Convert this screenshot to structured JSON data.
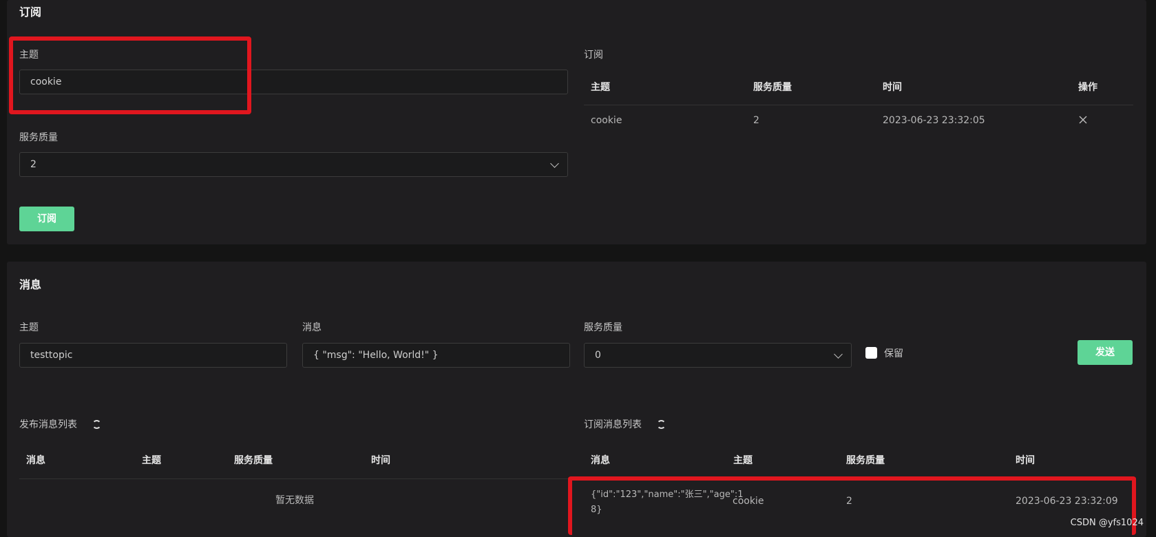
{
  "subscribe": {
    "title": "订阅",
    "topic_label": "主题",
    "topic_value": "cookie",
    "qos_label": "服务质量",
    "qos_value": "2",
    "button": "订阅",
    "list_title": "订阅",
    "headers": [
      "主题",
      "服务质量",
      "时间",
      "操作"
    ],
    "rows": [
      {
        "topic": "cookie",
        "qos": "2",
        "time": "2023-06-23 23:32:05"
      }
    ]
  },
  "message": {
    "title": "消息",
    "topic_label": "主题",
    "topic_value": "testtopic",
    "payload_label": "消息",
    "payload_value": "{ \"msg\": \"Hello, World!\" }",
    "qos_label": "服务质量",
    "qos_value": "0",
    "retain_label": "保留",
    "send_button": "发送",
    "published_title": "发布消息列表",
    "published_headers": [
      "消息",
      "主题",
      "服务质量",
      "时间"
    ],
    "published_empty": "暂无数据",
    "received_title": "订阅消息列表",
    "received_headers": [
      "消息",
      "主题",
      "服务质量",
      "时间"
    ],
    "received_rows": [
      {
        "message_line1": "{\"id\":\"123\",\"name\":\"张三\",\"age\":1",
        "message_line2": "8}",
        "topic": "cookie",
        "qos": "2",
        "time": "2023-06-23 23:32:09"
      }
    ]
  },
  "watermark": "CSDN @yfs1024",
  "colors": {
    "accent": "#5ed496",
    "highlight": "#e0161e",
    "panel": "#1f1e20"
  }
}
